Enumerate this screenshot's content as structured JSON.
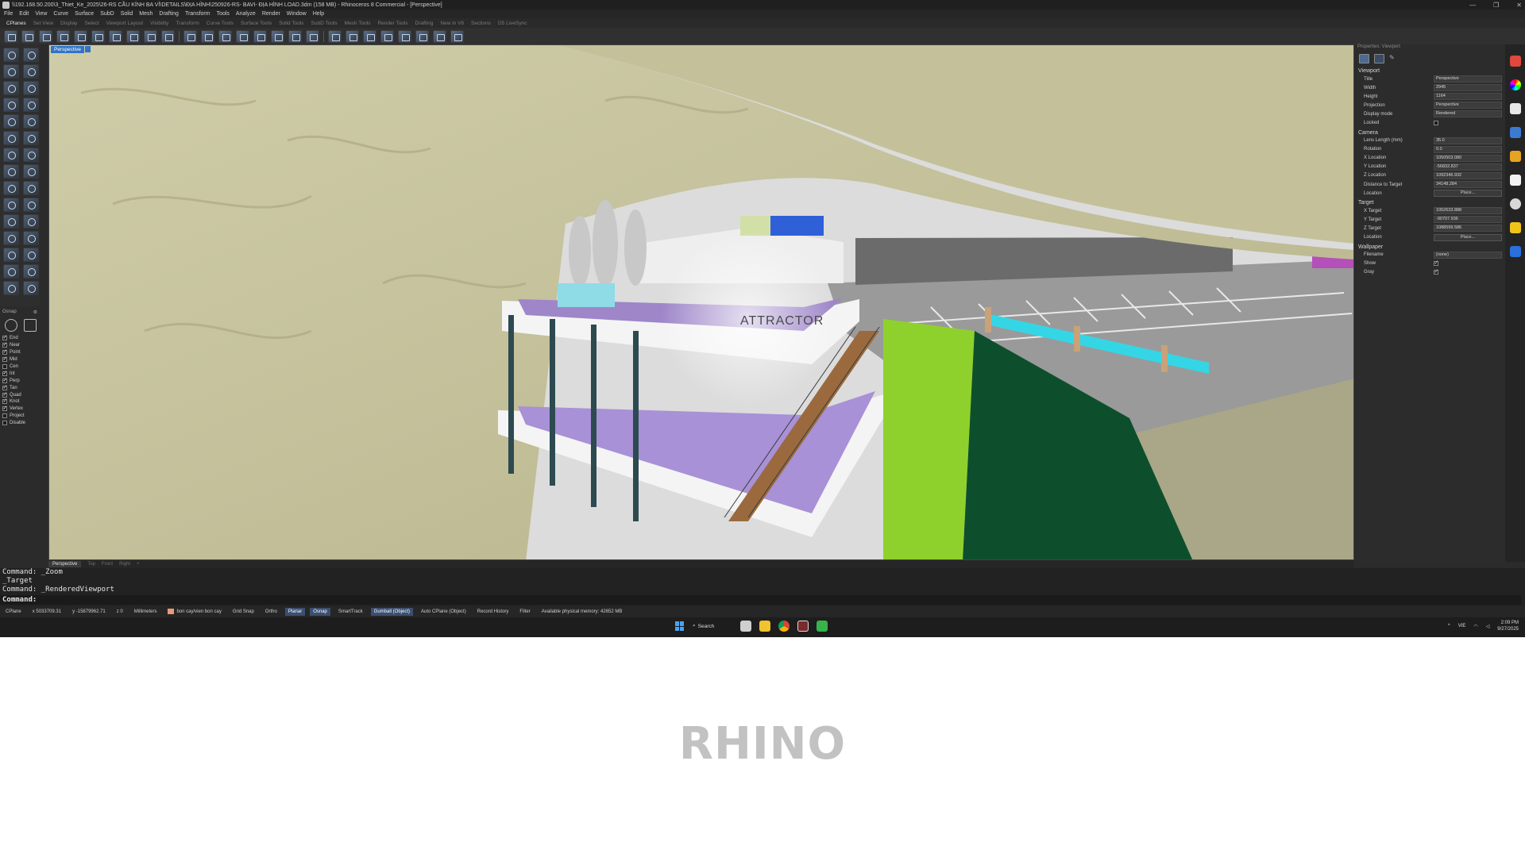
{
  "window": {
    "title": "\\\\192.168.50.200\\3_Thiet_Ke_2025\\26-RS CẦU KÍNH BA VÌ\\DETAILS\\ĐỊA HÌNH\\250926-RS- BAVI- ĐỊA HÌNH LOAD.3dm (158 MB) - Rhinoceros 8 Commercial - [Perspective]",
    "controls": [
      "—",
      "❐",
      "✕"
    ]
  },
  "menu": [
    "File",
    "Edit",
    "View",
    "Curve",
    "Surface",
    "SubD",
    "Solid",
    "Mesh",
    "Drafting",
    "Transform",
    "Tools",
    "Analyze",
    "Render",
    "Window",
    "Help"
  ],
  "toolbar_tabs": [
    "CPlanes",
    "Set View",
    "Display",
    "Select",
    "Viewport Layout",
    "Visibility",
    "Transform",
    "Curve Tools",
    "Surface Tools",
    "Solid Tools",
    "SubD Tools",
    "Mesh Tools",
    "Render Tools",
    "Drafting",
    "New in V8",
    "Sections",
    "D5 LiveSync"
  ],
  "viewport": {
    "label": "Perspective",
    "render_text": "ATTRACTOR",
    "tabs": [
      "Perspective",
      "Top",
      "Front",
      "Right",
      "+"
    ]
  },
  "osnap": {
    "header": "Osnap",
    "items": [
      {
        "label": "End",
        "checked": true
      },
      {
        "label": "Near",
        "checked": true
      },
      {
        "label": "Point",
        "checked": true
      },
      {
        "label": "Mid",
        "checked": true
      },
      {
        "label": "Cen",
        "checked": false
      },
      {
        "label": "Int",
        "checked": true
      },
      {
        "label": "Perp",
        "checked": true
      },
      {
        "label": "Tan",
        "checked": true
      },
      {
        "label": "Quad",
        "checked": true
      },
      {
        "label": "Knot",
        "checked": true
      },
      {
        "label": "Vertex",
        "checked": true
      },
      {
        "label": "Project",
        "checked": false
      },
      {
        "label": "Disable",
        "checked": false
      }
    ]
  },
  "properties": {
    "panel_title": "Properties: Viewport",
    "sections": [
      {
        "title": "Viewport",
        "rows": [
          {
            "label": "Title",
            "value": "Perspective",
            "kind": "field"
          },
          {
            "label": "Width",
            "value": "2945",
            "kind": "field"
          },
          {
            "label": "Height",
            "value": "1164",
            "kind": "field"
          },
          {
            "label": "Projection",
            "value": "Perspective",
            "kind": "field"
          },
          {
            "label": "Display mode",
            "value": "Rendered",
            "kind": "field"
          },
          {
            "label": "Locked",
            "value": "",
            "kind": "check",
            "checked": false
          }
        ]
      },
      {
        "title": "Camera",
        "rows": [
          {
            "label": "Lens Length (mm)",
            "value": "35.0",
            "kind": "field"
          },
          {
            "label": "Rotation",
            "value": "0.0",
            "kind": "field"
          },
          {
            "label": "X Location",
            "value": "1050503.080",
            "kind": "field"
          },
          {
            "label": "Y Location",
            "value": "-56832.837",
            "kind": "field"
          },
          {
            "label": "Z Location",
            "value": "1092346.932",
            "kind": "field"
          },
          {
            "label": "Distance to Target",
            "value": "34148.284",
            "kind": "field"
          },
          {
            "label": "Location",
            "value": "Place...",
            "kind": "button"
          }
        ]
      },
      {
        "title": "Target",
        "rows": [
          {
            "label": "X Target",
            "value": "1052633.888",
            "kind": "field"
          },
          {
            "label": "Y Target",
            "value": "-90707.936",
            "kind": "field"
          },
          {
            "label": "Z Target",
            "value": "1088599.586",
            "kind": "field"
          },
          {
            "label": "Location",
            "value": "Place...",
            "kind": "button"
          }
        ]
      },
      {
        "title": "Wallpaper",
        "rows": [
          {
            "label": "Filename",
            "value": "(none)",
            "kind": "field"
          },
          {
            "label": "Show",
            "value": "",
            "kind": "check",
            "checked": true
          },
          {
            "label": "Gray",
            "value": "",
            "kind": "check",
            "checked": true
          }
        ]
      }
    ]
  },
  "command": {
    "history": [
      "Command: _Zoom",
      "_Target",
      "Command: _RenderedViewport"
    ],
    "prompt": "Command:"
  },
  "status": {
    "cplane": "CPlane",
    "x": "x 5033709.31",
    "y": "y -15879962.71",
    "z": "z 0",
    "units": "Millimeters",
    "layer": "bon cay/vien bon cay",
    "layer_color": "#e89a7a",
    "toggles": [
      {
        "label": "Grid Snap",
        "on": false
      },
      {
        "label": "Ortho",
        "on": false
      },
      {
        "label": "Planar",
        "on": true
      },
      {
        "label": "Osnap",
        "on": true
      },
      {
        "label": "SmartTrack",
        "on": false
      },
      {
        "label": "Gumball (Object)",
        "on": true
      },
      {
        "label": "Auto CPlane (Object)",
        "on": false
      },
      {
        "label": "Record History",
        "on": false
      },
      {
        "label": "Filter",
        "on": false
      }
    ],
    "memory": "Available physical memory: 42652 MB"
  },
  "taskbar": {
    "search": "Search",
    "lang": "VIE",
    "time": "2:09 PM",
    "date": "9/27/2025"
  },
  "caption": "RHINO"
}
